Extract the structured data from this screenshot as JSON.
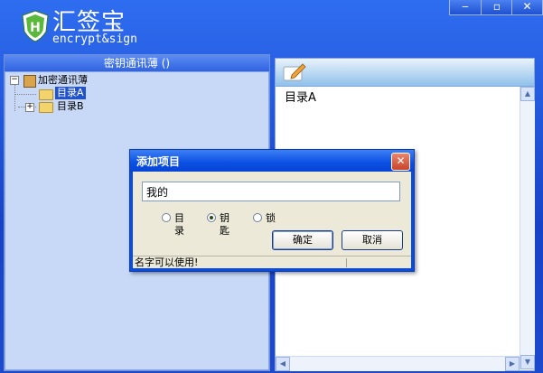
{
  "app": {
    "title": "汇签宝",
    "subtitle": "encrypt&sign"
  },
  "window_controls": {
    "minimize": "‒",
    "maximize": "▫",
    "close": "✕"
  },
  "left_panel": {
    "title": "密钥通讯薄 ()",
    "tree": {
      "root": {
        "label": "加密通讯薄",
        "expander": "−"
      },
      "items": [
        {
          "label": "目录A",
          "selected": true
        },
        {
          "label": "目录B",
          "expander": "+"
        }
      ]
    }
  },
  "right_panel": {
    "title": "目录A"
  },
  "dialog": {
    "title": "添加项目",
    "close": "✕",
    "input": {
      "value": "我的"
    },
    "radio_options": [
      {
        "label": "目录",
        "checked": false
      },
      {
        "label": "钥匙",
        "checked": true
      },
      {
        "label": "锁",
        "checked": false
      }
    ],
    "ok_label": "确定",
    "cancel_label": "取消",
    "status": "名字可以使用!"
  },
  "colors": {
    "title_bar": "#1843c7",
    "selection": "#2152c9",
    "dialog_face": "#ece9d8"
  }
}
